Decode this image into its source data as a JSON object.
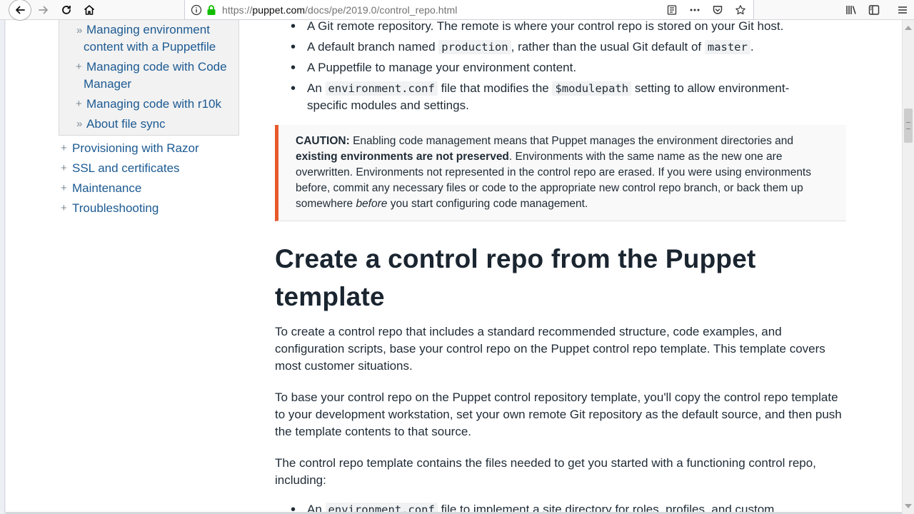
{
  "browser": {
    "url_prefix": "https://",
    "url_host": "puppet.com",
    "url_path": "/docs/pe/2019.0/control_repo.html"
  },
  "sidebar": {
    "sub_items": [
      {
        "marker": "»",
        "label_line1": "Managing environment",
        "label_line2": "content with a Puppetfile"
      },
      {
        "marker": "+",
        "label_line1": "Managing code with Code",
        "label_line2": "Manager"
      },
      {
        "marker": "+",
        "label_line1": "Managing code with r10k"
      },
      {
        "marker": "»",
        "label_line1": "About file sync"
      }
    ],
    "top_items": [
      {
        "marker": "+",
        "label": "Provisioning with Razor"
      },
      {
        "marker": "+",
        "label": "SSL and certificates"
      },
      {
        "marker": "+",
        "label": "Maintenance"
      },
      {
        "marker": "+",
        "label": "Troubleshooting"
      }
    ]
  },
  "content": {
    "list_items": {
      "item1": "A Git remote repository. The remote is where your control repo is stored on your Git host.",
      "item2_a": "A default branch named ",
      "item2_code1": "production",
      "item2_b": ", rather than the usual Git default of ",
      "item2_code2": "master",
      "item2_c": ".",
      "item3": "A Puppetfile to manage your environment content.",
      "item4_a": "An ",
      "item4_code1": "environment.conf",
      "item4_b": " file that modifies the ",
      "item4_code2": "$modulepath",
      "item4_c": " setting to allow environment-",
      "item4_d": "specific modules and settings."
    },
    "caution": {
      "label": "CAUTION:",
      "text1": " Enabling code management means that Puppet manages the environment directories and",
      "bold": "existing environments are not preserved",
      "text2": ". Environments with the same name as the new one are overwritten. Environments not represented in the control repo are erased. If you were using environments before, commit any necessary files or code to the appropriate new control repo branch, or back them up somewhere ",
      "italic": "before",
      "text3": " you start configuring code management."
    },
    "heading": "Create a control repo from the Puppet template",
    "para1": "To create a control repo that includes a standard recommended structure, code examples, and configuration scripts, base your control repo on the Puppet control repo template. This template covers most customer situations.",
    "para2": "To base your control repo on the Puppet control repository template, you'll copy the control repo template to your development workstation, set your own remote Git repository as the default source, and then push the template contents to that source.",
    "para3": "The control repo template contains the files needed to get you started with a functioning control repo, including:",
    "last_item_a": "An ",
    "last_item_code": "environment.conf",
    "last_item_b": " file to implement a site directory for roles, profiles, and custom"
  }
}
